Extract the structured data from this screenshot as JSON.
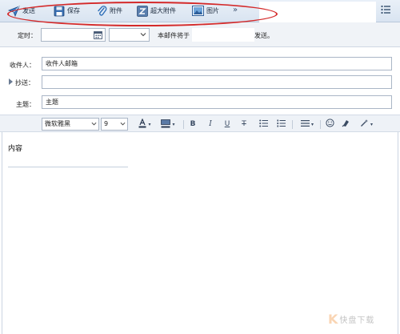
{
  "toolbar": {
    "send_label": "发送",
    "save_label": "保存",
    "attach_label": "附件",
    "big_attach_label": "超大附件",
    "picture_label": "图片",
    "more_label": "»"
  },
  "schedule": {
    "label": "定时：",
    "date_value": "",
    "time_value": "",
    "text_prefix": "本邮件将于",
    "text_suffix": "发送。"
  },
  "fields": {
    "to_label": "收件人：",
    "to_value": "收件人邮箱",
    "cc_label": "抄送：",
    "cc_value": "",
    "subject_label": "主题：",
    "subject_value": "主题"
  },
  "format": {
    "font_family": "微软雅黑",
    "font_size": "9",
    "bold": "B",
    "italic": "I",
    "underline": "U",
    "strike": "T"
  },
  "editor": {
    "content": "内容"
  },
  "watermark": {
    "logo": "K",
    "text": "快盘下载"
  },
  "colors": {
    "accent_red": "#d42a2a",
    "toolbar_bg": "#dfe8f3",
    "icon_blue": "#2f6fb8"
  }
}
